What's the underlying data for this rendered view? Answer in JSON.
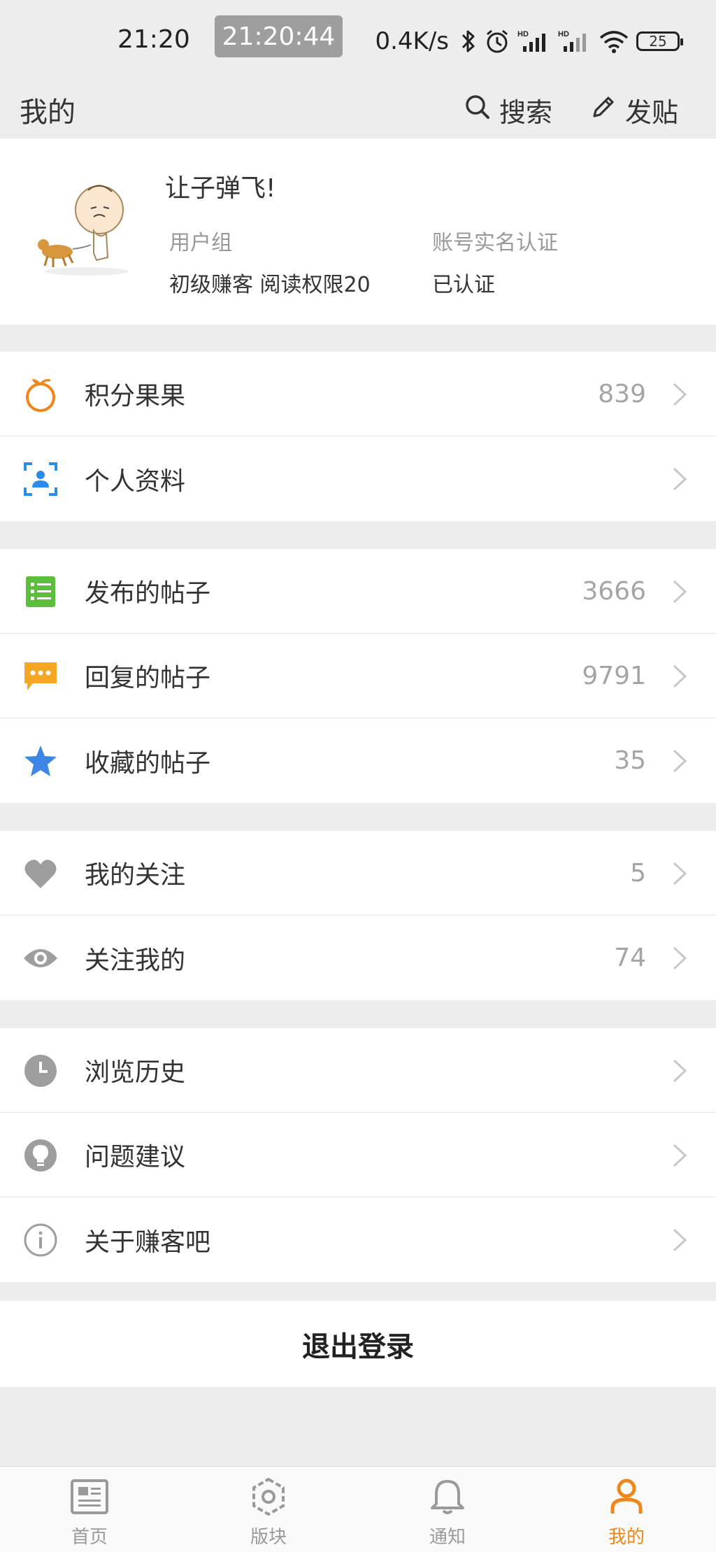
{
  "status_bar": {
    "time": "21:20",
    "clock_overlay": "21:20:44",
    "net_speed": "0.4K/s",
    "battery": "25"
  },
  "header": {
    "title": "我的",
    "search_label": "搜索",
    "post_label": "发贴"
  },
  "profile": {
    "username": "让子弹飞!",
    "group_label": "用户组",
    "group_value": "初级赚客 阅读权限20",
    "verify_label": "账号实名认证",
    "verify_value": "已认证"
  },
  "menu": {
    "points": {
      "label": "积分果果",
      "count": "839",
      "icon": "orange-icon",
      "color": "#f08519"
    },
    "profile_info": {
      "label": "个人资料",
      "icon": "profile-card-icon",
      "color": "#2a8ce6"
    },
    "posts": {
      "label": "发布的帖子",
      "count": "3666",
      "icon": "list-icon",
      "color": "#5bbf3c"
    },
    "replies": {
      "label": "回复的帖子",
      "count": "9791",
      "icon": "chat-bubble-icon",
      "color": "#f5a623"
    },
    "favorites": {
      "label": "收藏的帖子",
      "count": "35",
      "icon": "star-icon",
      "color": "#3e86e6"
    },
    "following": {
      "label": "我的关注",
      "count": "5",
      "icon": "heart-icon",
      "color": "#9e9e9e"
    },
    "followers": {
      "label": "关注我的",
      "count": "74",
      "icon": "eye-icon",
      "color": "#9e9e9e"
    },
    "history": {
      "label": "浏览历史",
      "icon": "clock-icon",
      "color": "#9e9e9e"
    },
    "feedback": {
      "label": "问题建议",
      "icon": "lightbulb-icon",
      "color": "#9e9e9e"
    },
    "about": {
      "label": "关于赚客吧",
      "icon": "info-icon",
      "color": "#9e9e9e"
    }
  },
  "logout_label": "退出登录",
  "tabs": [
    {
      "label": "首页",
      "icon": "news-icon",
      "active": false
    },
    {
      "label": "版块",
      "icon": "hexagon-icon",
      "active": false
    },
    {
      "label": "通知",
      "icon": "bell-icon",
      "active": false
    },
    {
      "label": "我的",
      "icon": "user-icon",
      "active": true
    }
  ],
  "colors": {
    "accent": "#f08519",
    "background": "#ededed",
    "muted": "#9e9e9e"
  }
}
